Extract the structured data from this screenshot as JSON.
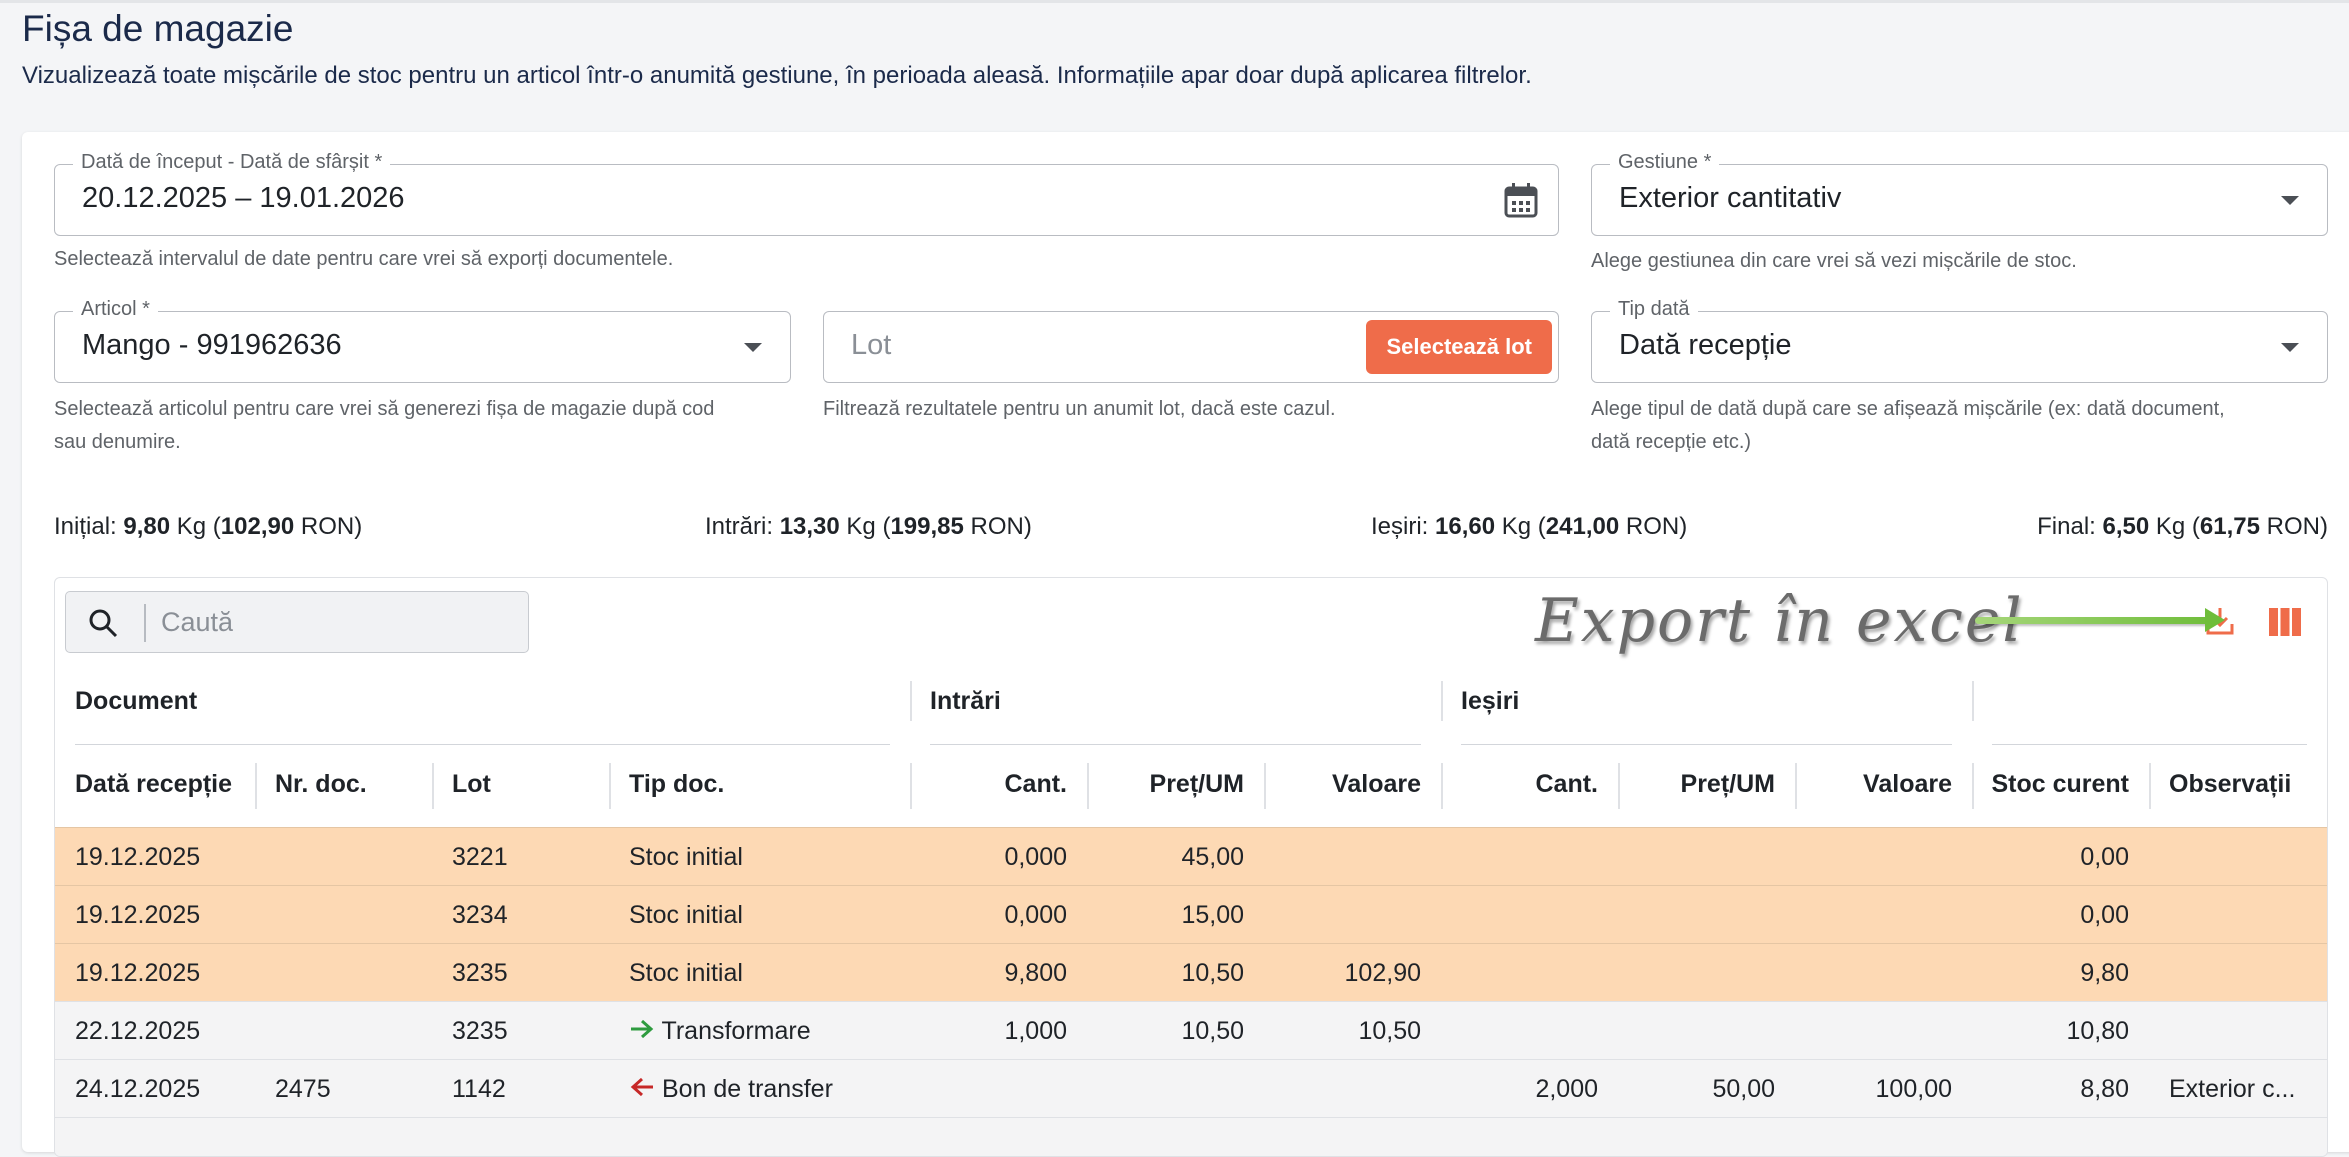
{
  "page": {
    "title": "Fișa de magazie",
    "subtitle": "Vizualizează toate mișcările de stoc pentru un articol într-o anumită gestiune, în perioada aleasă. Informațiile apar doar după aplicarea filtrelor."
  },
  "filters": {
    "date_range": {
      "label": "Dată de început - Dată de sfârșit *",
      "value": "20.12.2025 – 19.01.2026",
      "helper": "Selectează intervalul de date pentru care vrei să exporți documentele.",
      "icon": "calendar-icon"
    },
    "gestiune": {
      "label": "Gestiune *",
      "value": "Exterior cantitativ",
      "helper": "Alege gestiunea din care vrei să vezi mișcările de stoc."
    },
    "articol": {
      "label": "Articol *",
      "value": "Mango - 991962636",
      "helper_line1": "Selectează articolul pentru care vrei să generezi fișa de magazie după cod",
      "helper_line2": "sau denumire."
    },
    "lot": {
      "placeholder": "Lot",
      "button": "Selectează lot",
      "helper": "Filtrează rezultatele pentru un anumit lot, dacă este cazul."
    },
    "tip_data": {
      "label": "Tip dată",
      "value": "Dată recepție",
      "helper_line1": "Alege tipul de dată după care se afișează mișcările (ex: dată document,",
      "helper_line2": "dată recepție etc.)"
    }
  },
  "summary": {
    "initial": {
      "label": "Inițial:",
      "qty": "9,80",
      "unit": "Kg",
      "value": "102,90",
      "currency": "RON"
    },
    "intrari": {
      "label": "Intrări:",
      "qty": "13,30",
      "unit": "Kg",
      "value": "199,85",
      "currency": "RON"
    },
    "iesiri": {
      "label": "Ieșiri:",
      "qty": "16,60",
      "unit": "Kg",
      "value": "241,00",
      "currency": "RON"
    },
    "final": {
      "label": "Final:",
      "qty": "6,50",
      "unit": "Kg",
      "value": "61,75",
      "currency": "RON"
    }
  },
  "toolbar": {
    "search_placeholder": "Caută",
    "annotation": "Export în excel",
    "accent_color": "#ef6c4a"
  },
  "table": {
    "groups": {
      "document": "Document",
      "intrari": "Intrări",
      "iesiri": "Ieșiri"
    },
    "columns": {
      "data": "Dată recepție",
      "nr": "Nr. doc.",
      "lot": "Lot",
      "tip": "Tip doc.",
      "in_cant": "Cant.",
      "in_pret": "Preț/UM",
      "in_val": "Valoare",
      "out_cant": "Cant.",
      "out_pret": "Preț/UM",
      "out_val": "Valoare",
      "stoc": "Stoc curent",
      "obs": "Observații"
    },
    "rows": [
      {
        "data": "19.12.2025",
        "nr": "",
        "lot": "3221",
        "tip": "Stoc initial",
        "in_cant": "0,000",
        "in_pret": "45,00",
        "in_val": "",
        "out_cant": "",
        "out_pret": "",
        "out_val": "",
        "stoc": "0,00",
        "obs": ""
      },
      {
        "data": "19.12.2025",
        "nr": "",
        "lot": "3234",
        "tip": "Stoc initial",
        "in_cant": "0,000",
        "in_pret": "15,00",
        "in_val": "",
        "out_cant": "",
        "out_pret": "",
        "out_val": "",
        "stoc": "0,00",
        "obs": ""
      },
      {
        "data": "19.12.2025",
        "nr": "",
        "lot": "3235",
        "tip": "Stoc initial",
        "in_cant": "9,800",
        "in_pret": "10,50",
        "in_val": "102,90",
        "out_cant": "",
        "out_pret": "",
        "out_val": "",
        "stoc": "9,80",
        "obs": ""
      },
      {
        "data": "22.12.2025",
        "nr": "",
        "lot": "3235",
        "tip": "Transformare",
        "in_cant": "1,000",
        "in_pret": "10,50",
        "in_val": "10,50",
        "out_cant": "",
        "out_pret": "",
        "out_val": "",
        "stoc": "10,80",
        "obs": ""
      },
      {
        "data": "24.12.2025",
        "nr": "2475",
        "lot": "1142",
        "tip": "Bon de transfer",
        "in_cant": "",
        "in_pret": "",
        "in_val": "",
        "out_cant": "2,000",
        "out_pret": "50,00",
        "out_val": "100,00",
        "stoc": "8,80",
        "obs": "Exterior c..."
      }
    ]
  }
}
